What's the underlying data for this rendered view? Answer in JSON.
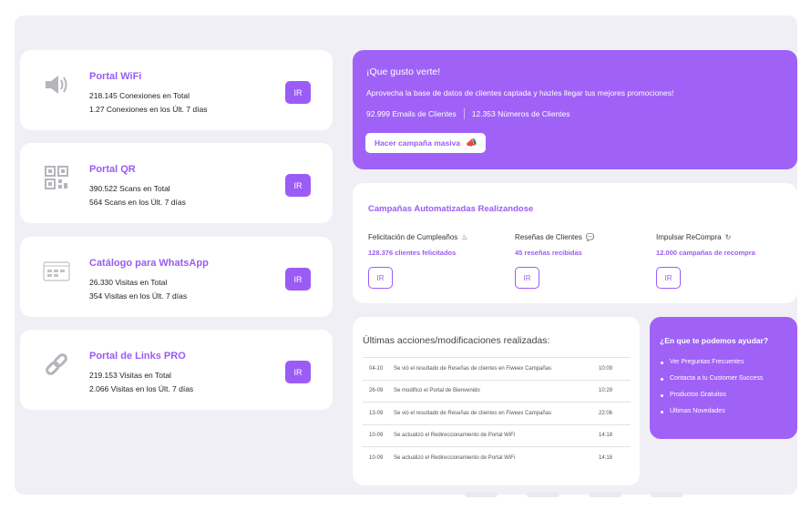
{
  "stat_cards": [
    {
      "icon": "wifi-signal-icon",
      "title": "Portal WiFi",
      "line1": "218.145 Conexiones en Total",
      "line2": "1.27 Conexiones en los Últ. 7 días",
      "button": "IR"
    },
    {
      "icon": "qr-code-icon",
      "title": "Portal QR",
      "line1": "390.522 Scans en Total",
      "line2": "564 Scans en los Últ. 7 días",
      "button": "IR"
    },
    {
      "icon": "catalog-icon",
      "title": "Catálogo para WhatsApp",
      "line1": "26.330 Visitas en Total",
      "line2": "354 Visitas en los Últ. 7 días",
      "button": "IR"
    },
    {
      "icon": "link-chain-icon",
      "title": "Portal de Links PRO",
      "line1": "219.153 Visitas en Total",
      "line2": "2.066 Visitas en los Últ. 7 días",
      "button": "IR"
    }
  ],
  "welcome": {
    "greeting": "¡Que gusto verte!",
    "description": "Aprovecha la base de datos de clientes captada y hazles llegar tus mejores promociones!",
    "emails": "92.999 Emails de Clientes",
    "phones": "12.353 Números de Clientes",
    "button": "Hacer campaña masiva",
    "button_icon": "megaphone-icon"
  },
  "automated": {
    "heading": "Campañas Automatizadas Realizandose",
    "items": [
      {
        "name": "Felicitación de Cumpleaños",
        "icon": "cake-icon",
        "value": "128.376 clientes felicitados",
        "button": "IR"
      },
      {
        "name": "Reseñas de Clientes",
        "icon": "speech-bubble-icon",
        "value": "45 reseñas recibidas",
        "button": "IR"
      },
      {
        "name": "Impulsar ReCompra",
        "icon": "refresh-icon",
        "value": "12.000 campañas de recompra",
        "button": "IR"
      }
    ]
  },
  "log": {
    "heading": "Últimas acciones/modificaciones realizadas:",
    "rows": [
      {
        "date": "04-10",
        "text": "Se vió el resultado de Reseñas de clientes en Fiweex Campañas",
        "time": "10:09"
      },
      {
        "date": "26-09",
        "text": "Se modificó el Portal de Bienvenido",
        "time": "10:29"
      },
      {
        "date": "13-09",
        "text": "Se vió el resultado de Reseñas de clientes en Fiweex Campañas",
        "time": "22:06"
      },
      {
        "date": "10-09",
        "text": "Se actualizó el Redireccionamiento de Portal WiFi",
        "time": "14:18"
      },
      {
        "date": "10-09",
        "text": "Se actualizó el Redireccionamiento de Portal WiFi",
        "time": "14:18"
      }
    ]
  },
  "help": {
    "heading": "¿En que te podemos ayudar?",
    "items": [
      "Ver Preguntas Frecuentes",
      "Contacta a tu Customer Success",
      "Productos Gratuitos",
      "Últimas Novedades"
    ]
  },
  "colors": {
    "accent": "#9b5cf6",
    "panel": "#a061f7",
    "background": "#efeff5"
  }
}
